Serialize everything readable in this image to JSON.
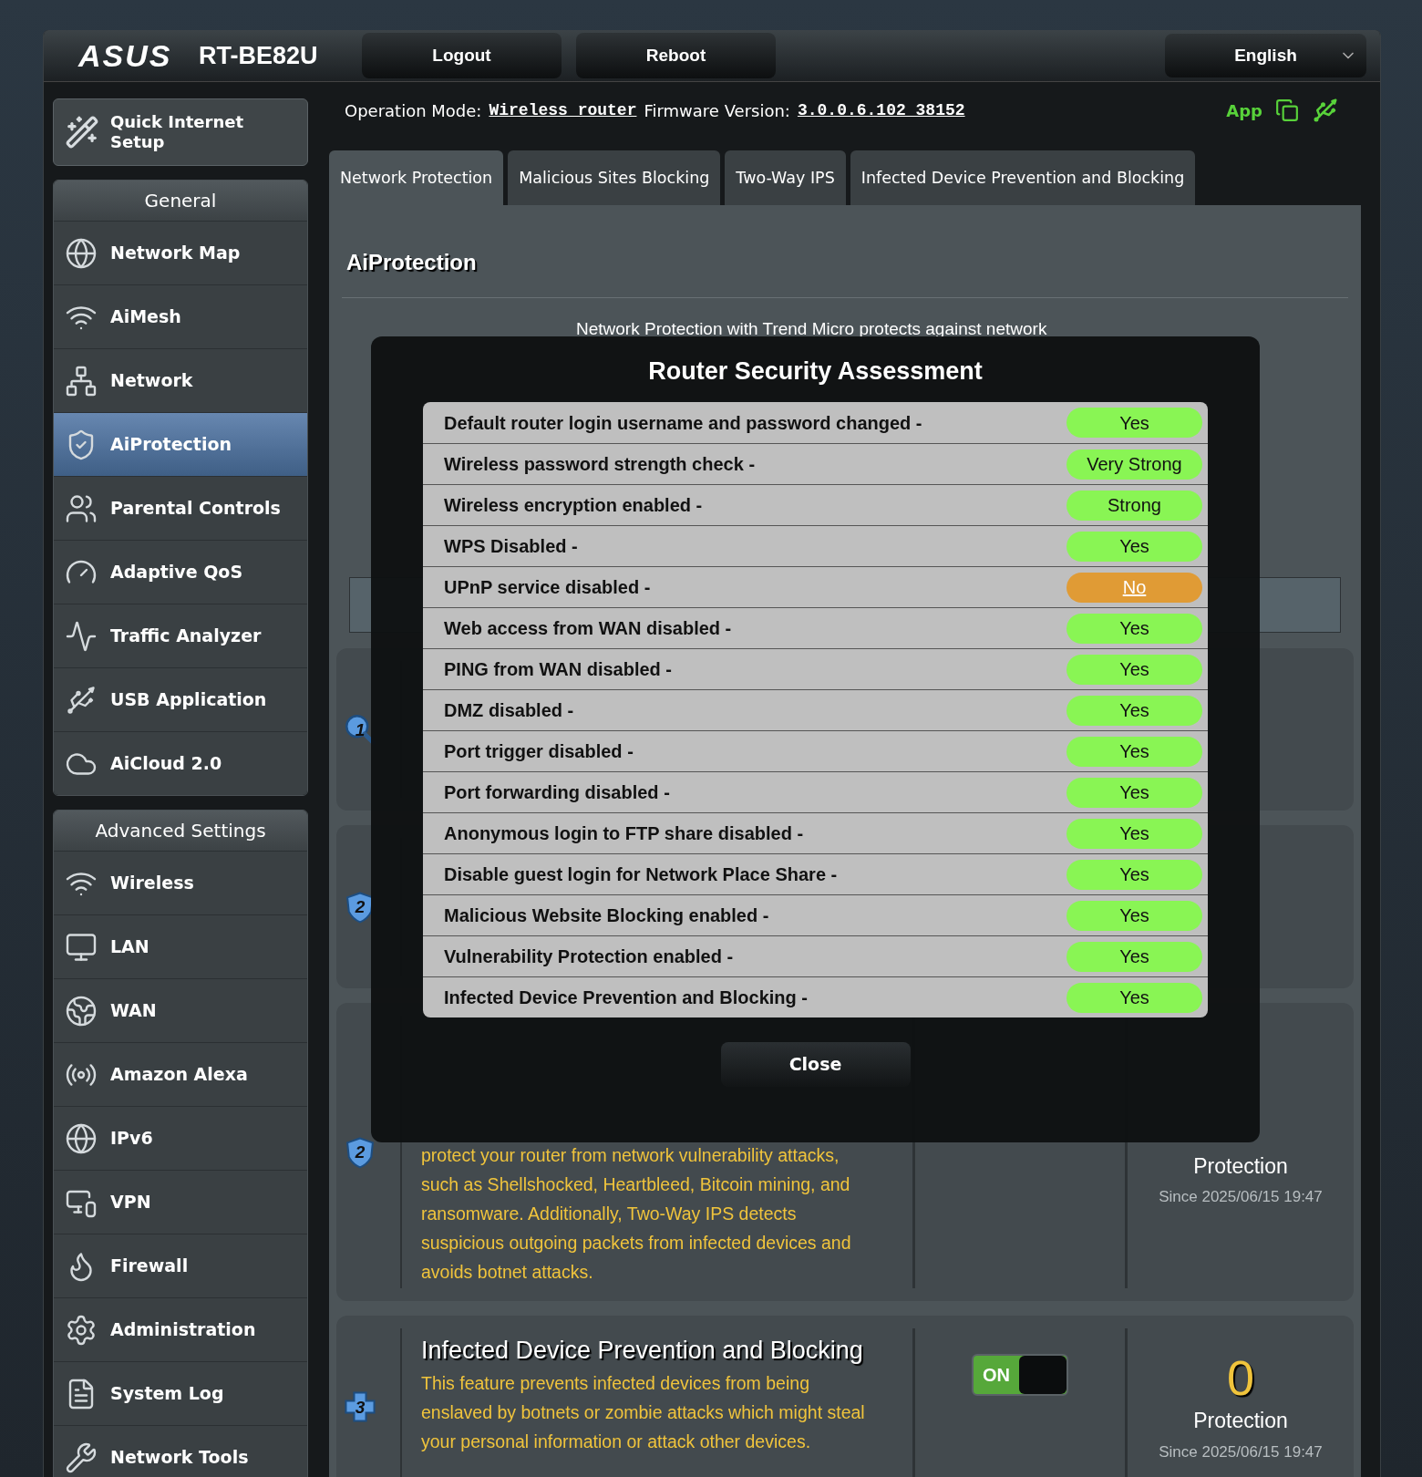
{
  "header": {
    "brand": "ASUS",
    "model": "RT-BE82U",
    "buttons": [
      "Logout",
      "Reboot"
    ],
    "language": "English"
  },
  "sidebar": {
    "quick_setup": "Quick Internet Setup",
    "sections": [
      {
        "title": "General",
        "items": [
          {
            "label": "Network Map",
            "selected": false
          },
          {
            "label": "AiMesh",
            "selected": false
          },
          {
            "label": "Network",
            "selected": false
          },
          {
            "label": "AiProtection",
            "selected": true
          },
          {
            "label": "Parental Controls",
            "selected": false
          },
          {
            "label": "Adaptive QoS",
            "selected": false
          },
          {
            "label": "Traffic Analyzer",
            "selected": false
          },
          {
            "label": "USB Application",
            "selected": false
          },
          {
            "label": "AiCloud 2.0",
            "selected": false
          }
        ]
      },
      {
        "title": "Advanced Settings",
        "items": [
          {
            "label": "Wireless",
            "selected": false
          },
          {
            "label": "LAN",
            "selected": false
          },
          {
            "label": "WAN",
            "selected": false
          },
          {
            "label": "Amazon Alexa",
            "selected": false
          },
          {
            "label": "IPv6",
            "selected": false
          },
          {
            "label": "VPN",
            "selected": false
          },
          {
            "label": "Firewall",
            "selected": false
          },
          {
            "label": "Administration",
            "selected": false
          },
          {
            "label": "System Log",
            "selected": false
          },
          {
            "label": "Network Tools",
            "selected": false
          }
        ]
      }
    ]
  },
  "status": {
    "mode_label": "Operation Mode:",
    "mode": "Wireless_router",
    "firmware_label": "Firmware Version:",
    "firmware": "3.0.0.6.102_38152",
    "app": "App"
  },
  "tabs": [
    {
      "label": "Network Protection",
      "selected": true
    },
    {
      "label": "Malicious Sites Blocking",
      "selected": false
    },
    {
      "label": "Two-Way IPS",
      "selected": false
    },
    {
      "label": "Infected Device Prevention and Blocking",
      "selected": false
    }
  ],
  "page_title": "AiProtection",
  "intro": "Network Protection with Trend Micro protects against network",
  "cards": [
    {
      "number": "1",
      "kind": "magnifier"
    },
    {
      "number": "2",
      "kind": "shield"
    },
    {
      "number": "2",
      "kind": "shield",
      "description": "protect your router from network vulnerability attacks, such as Shellshocked, Heartbleed, Bitcoin mining, and ransomware. Additionally, Two-Way IPS detects suspicious outgoing packets from infected devices and avoids botnet attacks.",
      "stat_label": "Protection",
      "since": "Since 2025/06/15 19:47"
    },
    {
      "number": "3",
      "kind": "cross",
      "title": "Infected Device Prevention and Blocking",
      "description": "This feature prevents infected devices from being enslaved by botnets or zombie attacks which might steal your personal information or attack other devices.",
      "toggle": {
        "label": "ON",
        "on": true
      },
      "count": "0",
      "stat_label": "Protection",
      "since": "Since 2025/06/15 19:47"
    }
  ],
  "modal": {
    "title": "Router Security Assessment",
    "rows": [
      {
        "label": "Default router login username and password changed -",
        "value": "Yes",
        "ok": true
      },
      {
        "label": "Wireless password strength check -",
        "value": "Very Strong",
        "ok": true
      },
      {
        "label": "Wireless encryption enabled -",
        "value": "Strong",
        "ok": true
      },
      {
        "label": "WPS Disabled -",
        "value": "Yes",
        "ok": true
      },
      {
        "label": "UPnP service disabled -",
        "value": "No",
        "ok": false
      },
      {
        "label": "Web access from WAN disabled -",
        "value": "Yes",
        "ok": true
      },
      {
        "label": "PING from WAN disabled -",
        "value": "Yes",
        "ok": true
      },
      {
        "label": "DMZ disabled -",
        "value": "Yes",
        "ok": true
      },
      {
        "label": "Port trigger disabled -",
        "value": "Yes",
        "ok": true
      },
      {
        "label": "Port forwarding disabled -",
        "value": "Yes",
        "ok": true
      },
      {
        "label": "Anonymous login to FTP share disabled -",
        "value": "Yes",
        "ok": true
      },
      {
        "label": "Disable guest login for Network Place Share -",
        "value": "Yes",
        "ok": true
      },
      {
        "label": "Malicious Website Blocking enabled -",
        "value": "Yes",
        "ok": true
      },
      {
        "label": "Vulnerability Protection enabled -",
        "value": "Yes",
        "ok": true
      },
      {
        "label": "Infected Device Prevention and Blocking -",
        "value": "Yes",
        "ok": true
      }
    ],
    "close": "Close"
  }
}
